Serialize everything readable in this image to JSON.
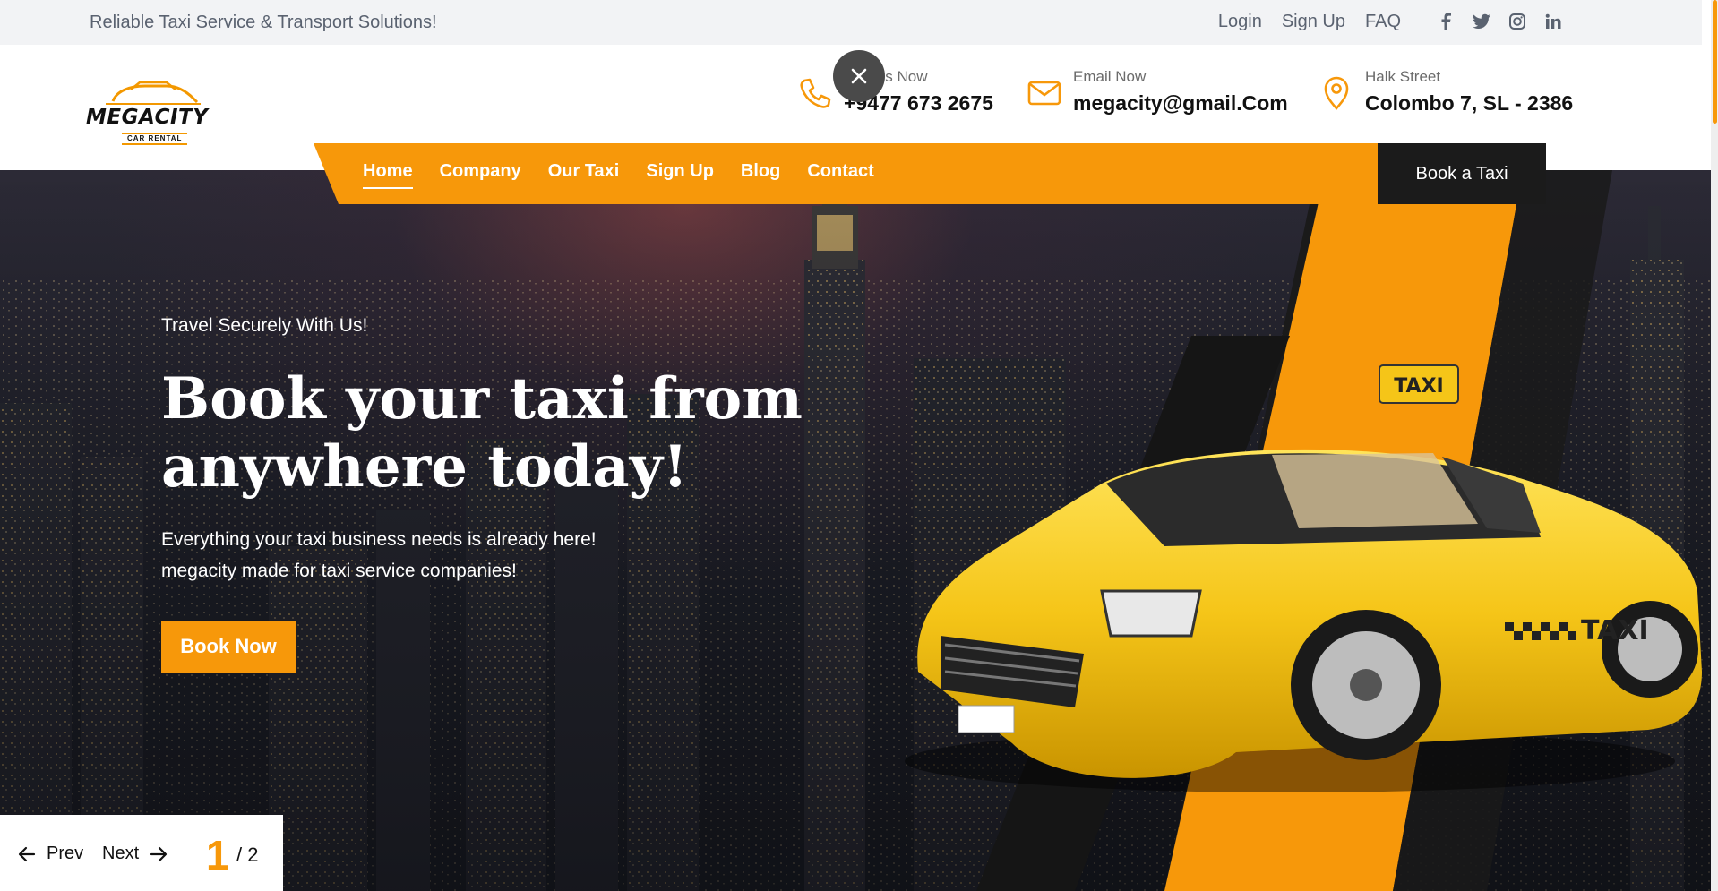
{
  "topbar": {
    "tagline": "Reliable Taxi Service & Transport Solutions!",
    "links": [
      "Login",
      "Sign Up",
      "FAQ"
    ],
    "social": [
      "facebook-icon",
      "twitter-icon",
      "instagram-icon",
      "linkedin-icon"
    ]
  },
  "logo": {
    "name": "MEGACITY",
    "sub": "CAR RENTAL"
  },
  "contacts": [
    {
      "icon": "phone-icon",
      "label": "Call Us Now",
      "value": "+9477 673 2675"
    },
    {
      "icon": "mail-icon",
      "label": "Email Now",
      "value": "megacity@gmail.Com"
    },
    {
      "icon": "location-pin-icon",
      "label": "Halk Street",
      "value": "Colombo 7, SL - 2386"
    }
  ],
  "nav": {
    "items": [
      "Home",
      "Company",
      "Our Taxi",
      "Sign Up",
      "Blog",
      "Contact"
    ],
    "active": "Home",
    "book_label": "Book a Taxi"
  },
  "hero": {
    "subtitle": "Travel Securely With Us!",
    "headline_line1": "Book your taxi from",
    "headline_line2": "anywhere today!",
    "desc_line1": "Everything your taxi business needs is already here!",
    "desc_line2": "megacity made for taxi service companies!",
    "cta": "Book Now",
    "taxi_sign": "TAXI",
    "door_text": "TAXI"
  },
  "slider": {
    "prev": "Prev",
    "next": "Next",
    "current": "1",
    "total": "/ 2"
  },
  "colors": {
    "accent": "#f7980a",
    "dark": "#1b1b1b",
    "taxi_yellow": "#f5c518"
  }
}
